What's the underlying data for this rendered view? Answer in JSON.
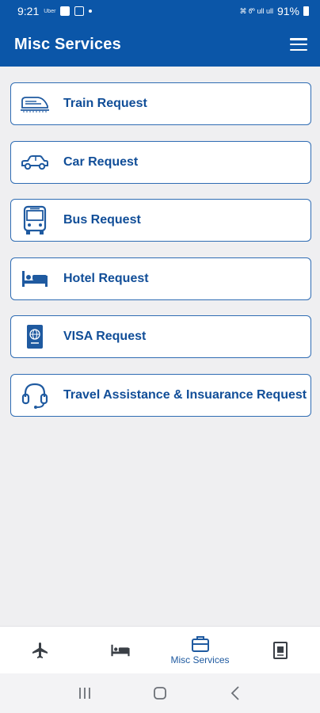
{
  "status_bar": {
    "time": "9:21",
    "small_text": "Uber",
    "right_mini": "⌘ Ꮫ ull ull",
    "battery": "91%"
  },
  "header": {
    "title": "Misc Services",
    "menu_icon": "menu-icon"
  },
  "services": [
    {
      "label": "Train Request",
      "icon": "train-icon"
    },
    {
      "label": "Car Request",
      "icon": "car-icon"
    },
    {
      "label": "Bus Request",
      "icon": "bus-icon"
    },
    {
      "label": "Hotel Request",
      "icon": "hotel-bed-icon"
    },
    {
      "label": "VISA Request",
      "icon": "passport-icon"
    },
    {
      "label": "Travel Assistance & Insuarance Request",
      "icon": "headset-icon"
    }
  ],
  "bottom_nav": [
    {
      "icon": "airplane-icon",
      "label": ""
    },
    {
      "icon": "bed-icon",
      "label": ""
    },
    {
      "icon": "briefcase-icon",
      "label": "Misc Services",
      "active": true
    },
    {
      "icon": "document-icon",
      "label": ""
    }
  ],
  "colors": {
    "primary": "#0b56a8",
    "accent_text": "#114e98",
    "border": "#2f6cb3",
    "background": "#efeff1"
  }
}
